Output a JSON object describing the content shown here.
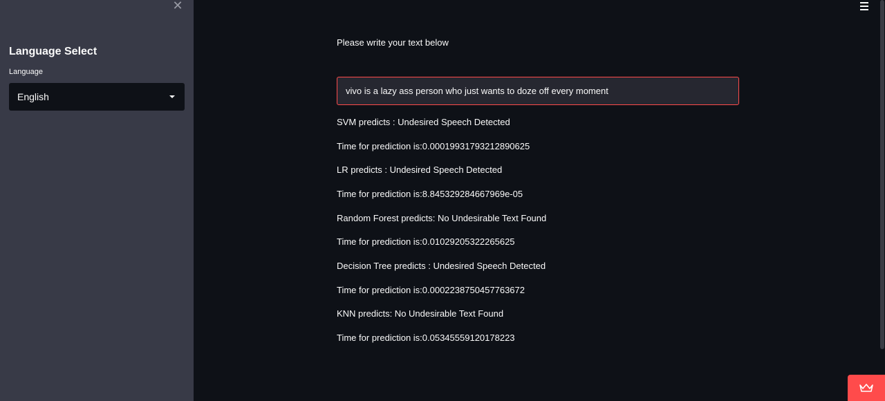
{
  "sidebar": {
    "close_symbol": "✕",
    "title": "Language Select",
    "select_label": "Language",
    "selected_language": "English"
  },
  "main": {
    "prompt": "Please write your text below",
    "input_value": "vivo is a lazy ass person who just wants to doze off every moment",
    "results": [
      "SVM predicts : Undesired Speech Detected",
      "Time for prediction is:0.00019931793212890625",
      "LR predicts : Undesired Speech Detected",
      "Time for prediction is:8.845329284667969e-05",
      "Random Forest predicts: No Undesirable Text Found",
      "Time for prediction is:0.01029205322265625",
      "Decision Tree predicts : Undesired Speech Detected",
      "Time for prediction is:0.0002238750457763672",
      "KNN predicts: No Undesirable Text Found",
      "Time for prediction is:0.05345559120178223"
    ]
  },
  "icons": {
    "close": "close-icon",
    "menu": "hamburger-menu-icon",
    "caret": "chevron-down-icon",
    "badge": "crown-icon"
  },
  "colors": {
    "sidebar_bg": "#383a47",
    "main_bg": "#0e1117",
    "accent": "#ff4b4b",
    "input_bg": "#262730",
    "text": "#fafafa"
  }
}
